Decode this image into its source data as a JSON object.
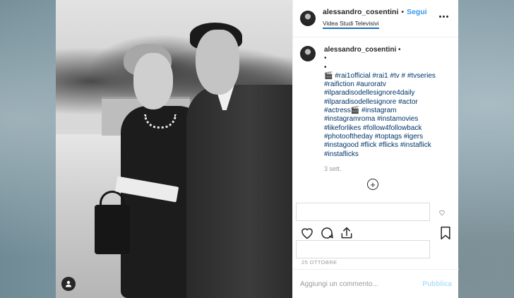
{
  "post": {
    "username": "alessandro_cosentini",
    "separator": "•",
    "follow_label": "Segui",
    "location": "Videa Studi Televisivi",
    "more_icon": "more-horizontal-icon"
  },
  "caption": {
    "author": "alessandro_cosentini",
    "author_suffix": "•",
    "bullet1": "•",
    "bullet2": "•",
    "lines": [
      "🎬 #rai1official #rai1 #tv # #tvseries",
      "#raifiction #auroratv",
      "#ilparadisodellesignore4daily",
      "#ilparadisodellesignore #actor",
      "#actress🎬 #instagram",
      "#instagramroma #instamovies",
      "#likeforlikes #follow4followback",
      "#photooftheday #toptags #igers",
      "#instagood #flick #flicks #instaflick",
      "#instaflicks"
    ],
    "time_ago": "3 sett."
  },
  "load_more_symbol": "+",
  "date": "25 OTTOBRE",
  "add_comment": {
    "placeholder": "Aggiungi un commento...",
    "publish_label": "Pubblica"
  },
  "icons": {
    "like": "heart-icon",
    "comment": "comment-icon",
    "share": "share-icon",
    "save": "bookmark-icon",
    "tag": "user-tag-icon"
  },
  "colors": {
    "accent": "#3897f0",
    "hashtag": "#003569",
    "muted": "#999999"
  }
}
